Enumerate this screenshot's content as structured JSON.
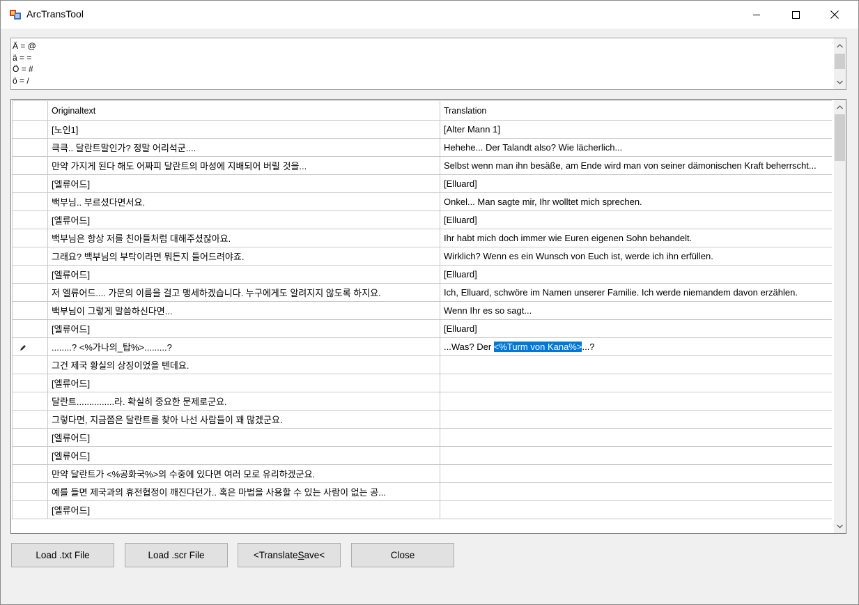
{
  "window": {
    "title": "ArcTransTool"
  },
  "mapping": {
    "lines": [
      "Ä = @",
      "ä = =",
      "Ö = #",
      "ö = /"
    ]
  },
  "grid": {
    "columns": {
      "original": "Originaltext",
      "translation": "Translation"
    },
    "rows": [
      {
        "original": "[노인1]",
        "translation": "[Alter Mann 1]"
      },
      {
        "original": "큭큭.. 달란트말인가? 정말 어리석군....",
        "translation": "Hehehe... Der Talandt also? Wie lächerlich..."
      },
      {
        "original": "만약 가지게 된다 해도 어짜피 달란트의 마성에 지배되어 버릴 것을...",
        "translation": "Selbst wenn man ihn besäße, am Ende wird man von seiner dämonischen Kraft beherrscht..."
      },
      {
        "original": "[엘류어드]",
        "translation": "[Elluard]"
      },
      {
        "original": "백부님.. 부르셨다면서요.",
        "translation": "Onkel... Man sagte mir, Ihr wolltet mich sprechen."
      },
      {
        "original": "[엘류어드]",
        "translation": "[Elluard]"
      },
      {
        "original": "백부님은 항상 저를 친아들처럼 대해주셨잖아요.",
        "translation": "Ihr habt mich doch immer wie Euren eigenen Sohn behandelt."
      },
      {
        "original": "그래요? 백부님의 부탁이라면 뭐든지 들어드려야죠.",
        "translation": "Wirklich? Wenn es ein Wunsch von Euch ist, werde ich ihn erfüllen."
      },
      {
        "original": "[엘류어드]",
        "translation": "[Elluard]"
      },
      {
        "original": "저 엘류어드.... 가문의 이름을 걸고 맹세하겠습니다. 누구에게도 알려지지 않도록 하지요.",
        "translation": "Ich, Elluard, schwöre im Namen unserer Familie. Ich werde niemandem davon erzählen."
      },
      {
        "original": "백부님이 그렇게 말씀하신다면...",
        "translation": "Wenn Ihr es so sagt..."
      },
      {
        "original": "[엘류어드]",
        "translation": "[Elluard]"
      },
      {
        "original": "........? <%가나의_탑%>.........?",
        "editing": true,
        "translation_pre": "...Was? Der ",
        "translation_sel": "<%Turm von Kana%>",
        "translation_post": "...?"
      },
      {
        "original": "그건 제국 황실의 상징이었을 텐데요.",
        "translation": ""
      },
      {
        "original": "[엘류어드]",
        "translation": ""
      },
      {
        "original": "달란트...............라. 확실히 중요한 문제로군요.",
        "translation": ""
      },
      {
        "original": "그렇다면, 지금쯤은 달란트를 찾아 나선 사람들이 꽤 많겠군요.",
        "translation": ""
      },
      {
        "original": "[엘류어드]",
        "translation": ""
      },
      {
        "original": "[엘류어드]",
        "translation": ""
      },
      {
        "original": "만약 달란트가 <%공화국%>의 수중에 있다면 여러 모로 유리하겠군요.",
        "translation": ""
      },
      {
        "original": "예를 들면 제국과의 휴전협정이 깨진다던가.. 혹은 마법을 사용할 수 있는 사람이 없는 공...",
        "translation": ""
      },
      {
        "original": "[엘류어드]",
        "translation": ""
      }
    ]
  },
  "buttons": {
    "load_txt": "Load .txt File",
    "load_scr": "Load .scr File",
    "translate_save": "<TranslateSave<",
    "close": "Close"
  },
  "icons": {
    "app": "app-icon",
    "minimize": "minimize-icon",
    "maximize": "maximize-icon",
    "close": "close-icon",
    "edit_row": "pencil-icon"
  },
  "colors": {
    "selection": "#0078d7",
    "window_bg": "#f0f0f0",
    "button_bg": "#e1e1e1"
  }
}
